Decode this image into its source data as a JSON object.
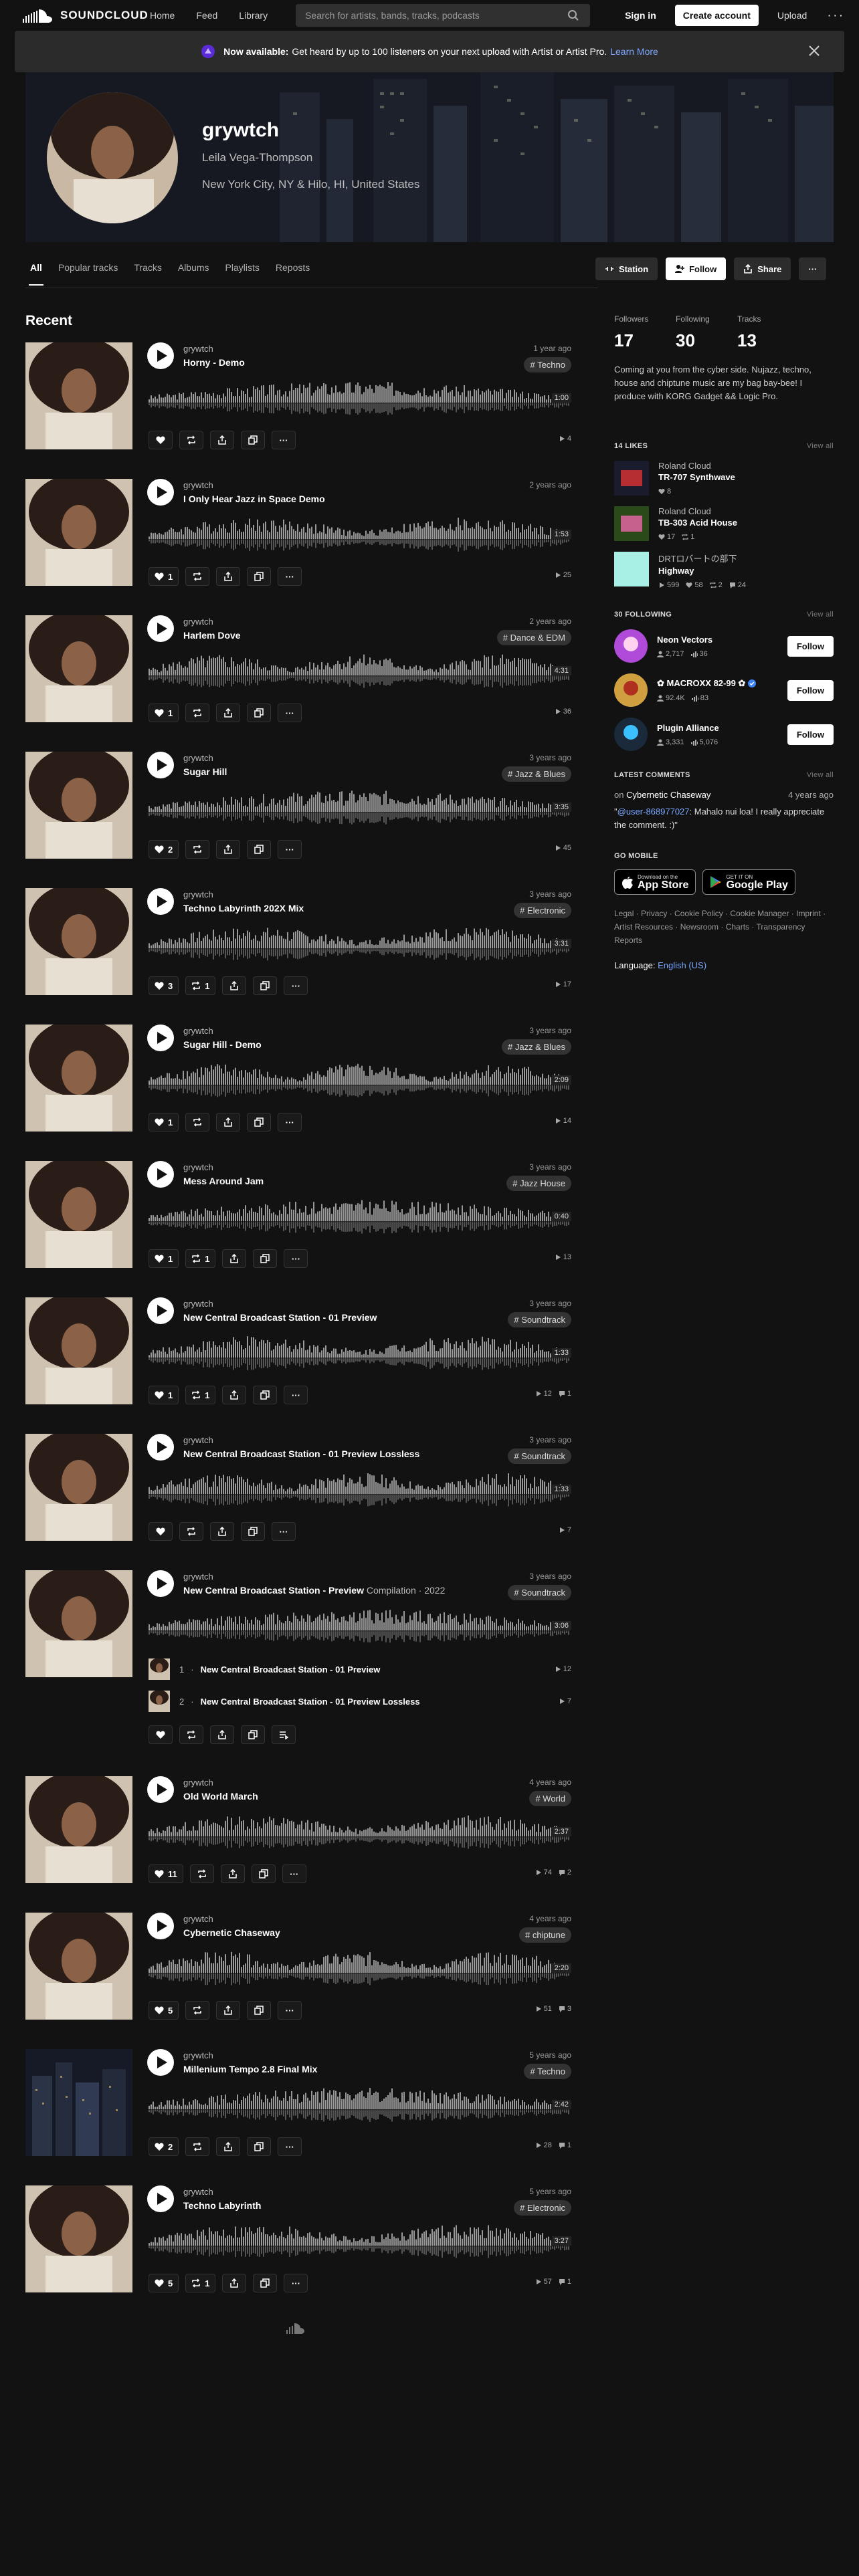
{
  "nav": {
    "logo": "SOUNDCLOUD",
    "links": [
      "Home",
      "Feed",
      "Library"
    ],
    "search_placeholder": "Search for artists, bands, tracks, podcasts",
    "sign_in": "Sign in",
    "create_account": "Create account",
    "upload": "Upload"
  },
  "banner": {
    "bold": "Now available:",
    "text": "Get heard by up to 100 listeners on your next upload with Artist or Artist Pro.",
    "link": "Learn More"
  },
  "profile": {
    "username": "grywtch",
    "real_name": "Leila Vega-Thompson",
    "location": "New York City, NY & Hilo, HI, United States"
  },
  "tabs": [
    "All",
    "Popular tracks",
    "Tracks",
    "Albums",
    "Playlists",
    "Reposts"
  ],
  "profile_actions": {
    "station": "Station",
    "follow": "Follow",
    "share": "Share"
  },
  "recent_title": "Recent",
  "tracks": [
    {
      "user": "grywtch",
      "title": "Horny - Demo",
      "age": "1 year ago",
      "genre": "# Techno",
      "duration": "1:00",
      "likes": "",
      "reposts": "",
      "plays": "4",
      "comments": ""
    },
    {
      "user": "grywtch",
      "title": "I Only Hear Jazz in Space Demo",
      "age": "2 years ago",
      "genre": "",
      "duration": "1:53",
      "likes": "1",
      "reposts": "",
      "plays": "25",
      "comments": ""
    },
    {
      "user": "grywtch",
      "title": "Harlem Dove",
      "age": "2 years ago",
      "genre": "# Dance & EDM",
      "duration": "4:31",
      "likes": "1",
      "reposts": "",
      "plays": "36",
      "comments": ""
    },
    {
      "user": "grywtch",
      "title": "Sugar Hill",
      "age": "3 years ago",
      "genre": "# Jazz & Blues",
      "duration": "3:35",
      "likes": "2",
      "reposts": "",
      "plays": "45",
      "comments": ""
    },
    {
      "user": "grywtch",
      "title": "Techno Labyrinth 202X Mix",
      "age": "3 years ago",
      "genre": "# Electronic",
      "duration": "3:31",
      "likes": "3",
      "reposts": "1",
      "plays": "17",
      "comments": ""
    },
    {
      "user": "grywtch",
      "title": "Sugar Hill - Demo",
      "age": "3 years ago",
      "genre": "# Jazz & Blues",
      "duration": "2:09",
      "likes": "1",
      "reposts": "",
      "plays": "14",
      "comments": ""
    },
    {
      "user": "grywtch",
      "title": "Mess Around Jam",
      "age": "3 years ago",
      "genre": "# Jazz House",
      "duration": "0:40",
      "likes": "1",
      "reposts": "1",
      "plays": "13",
      "comments": ""
    },
    {
      "user": "grywtch",
      "title": "New Central Broadcast Station - 01 Preview",
      "age": "3 years ago",
      "genre": "# Soundtrack",
      "duration": "1:33",
      "likes": "1",
      "reposts": "1",
      "plays": "12",
      "comments": "1"
    },
    {
      "user": "grywtch",
      "title": "New Central Broadcast Station - 01 Preview Lossless",
      "age": "3 years ago",
      "genre": "# Soundtrack",
      "duration": "1:33",
      "likes": "",
      "reposts": "",
      "plays": "7",
      "comments": ""
    },
    {
      "user": "grywtch",
      "title": "New Central Broadcast Station - Preview",
      "sub": "Compilation · 2022",
      "age": "3 years ago",
      "genre": "# Soundtrack",
      "duration": "3:06",
      "likes": "",
      "reposts": "",
      "plays": "",
      "comments": ""
    },
    {
      "user": "grywtch",
      "title": "Old World March",
      "age": "4 years ago",
      "genre": "# World",
      "duration": "2:37",
      "likes": "11",
      "reposts": "",
      "plays": "74",
      "comments": "2"
    },
    {
      "user": "grywtch",
      "title": "Cybernetic Chaseway",
      "age": "4 years ago",
      "genre": "# chiptune",
      "duration": "2:20",
      "likes": "5",
      "reposts": "",
      "plays": "51",
      "comments": "3"
    },
    {
      "user": "grywtch",
      "title": "Millenium Tempo 2.8 Final Mix",
      "age": "5 years ago",
      "genre": "# Techno",
      "duration": "2:42",
      "likes": "2",
      "reposts": "",
      "plays": "28",
      "comments": "1"
    },
    {
      "user": "grywtch",
      "title": "Techno Labyrinth",
      "age": "5 years ago",
      "genre": "# Electronic",
      "duration": "3:27",
      "likes": "5",
      "reposts": "1",
      "plays": "57",
      "comments": "1"
    }
  ],
  "set_items": [
    {
      "index": "1",
      "title": "New Central Broadcast Station - 01 Preview",
      "plays": "12"
    },
    {
      "index": "2",
      "title": "New Central Broadcast Station - 01 Preview Lossless",
      "plays": "7"
    }
  ],
  "sidebar": {
    "followers_label": "Followers",
    "followers": "17",
    "following_label": "Following",
    "following": "30",
    "tracks_label": "Tracks",
    "tracks": "13",
    "bio": "Coming at you from the cyber side. Nujazz, techno, house and chiptune music are my bag bay-bee! I produce with KORG Gadget && Logic Pro.",
    "likes_head": "14 LIKES",
    "view_all": "View all",
    "likes": [
      {
        "user": "Roland Cloud",
        "title": "TR-707 Synthwave",
        "plays": "",
        "likes": "8",
        "reposts": "",
        "comments": ""
      },
      {
        "user": "Roland Cloud",
        "title": "TB-303 Acid House",
        "plays": "",
        "likes": "17",
        "reposts": "1",
        "comments": ""
      },
      {
        "user": "DRTロバートの部下",
        "title": "Highway",
        "plays": "599",
        "likes": "58",
        "reposts": "2",
        "comments": "24"
      }
    ],
    "following_head": "30 FOLLOWING",
    "following_list": [
      {
        "name": "Neon Vectors",
        "followers": "2,717",
        "tracks": "36"
      },
      {
        "name": "✿ MACROXX 82-99 ✿",
        "followers": "92.4K",
        "tracks": "83"
      },
      {
        "name": "Plugin Alliance",
        "followers": "3,331",
        "tracks": "5,076"
      }
    ],
    "follow_label": "Follow",
    "comments_head": "LATEST COMMENTS",
    "comment_on": "on",
    "comment_track": "Cybernetic Chaseway",
    "comment_age": "4 years ago",
    "comment_mention": "@user-868977027",
    "comment_text": ": Mahalo nui loa! I really appreciate the comment. :)\"",
    "comment_quote": "\"",
    "gomobile_head": "GO MOBILE",
    "appstore_small": "Download on the",
    "appstore_big": "App Store",
    "gplay_small": "GET IT ON",
    "gplay_big": "Google Play",
    "legal": "Legal · Privacy · Cookie Policy · Cookie Manager · Imprint · Artist Resources · Newsroom · Charts · Transparency Reports",
    "language_label": "Language:",
    "language_value": "English (US)"
  }
}
